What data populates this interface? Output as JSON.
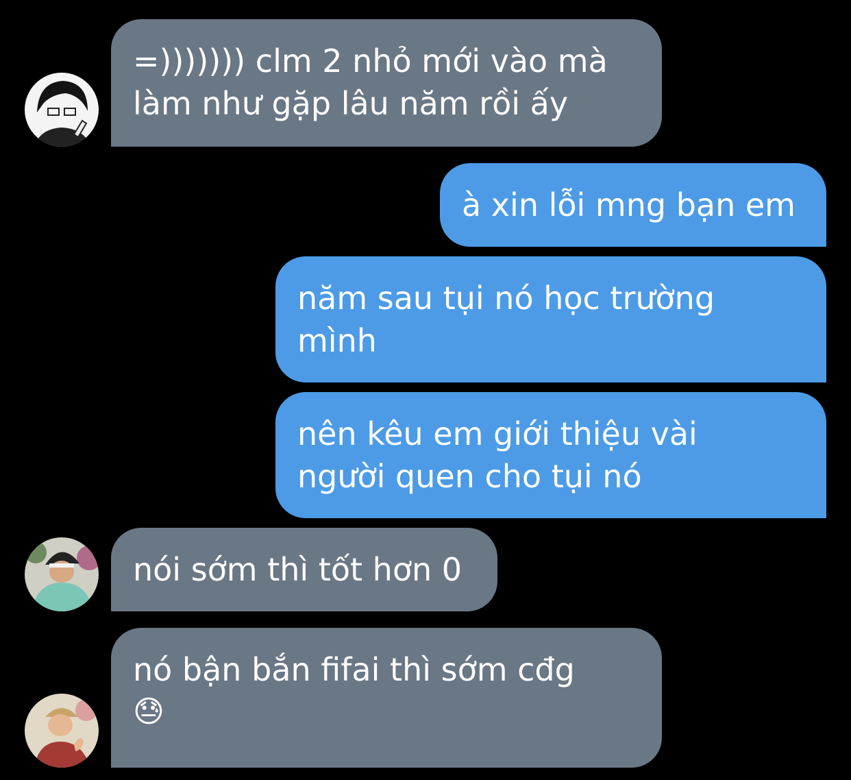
{
  "theme": {
    "background": "#000000",
    "incoming_bubble": "#6a7785",
    "outgoing_bubble": "#4d9be6",
    "text": "#ffffff"
  },
  "messages": [
    {
      "direction": "incoming",
      "avatar": "avatar-glasses-boy",
      "lines": [
        "=))))))) clm 2 nhỏ mới vào mà",
        "làm như gặp lâu năm rồi ấy"
      ]
    },
    {
      "direction": "outgoing",
      "lines": [
        "à xin lỗi mng bạn em"
      ]
    },
    {
      "direction": "outgoing",
      "lines": [
        "năm sau tụi nó học trường",
        "mình"
      ]
    },
    {
      "direction": "outgoing",
      "lines": [
        "nên kêu em giới thiệu vài",
        "người quen cho tụi nó"
      ]
    },
    {
      "direction": "incoming",
      "avatar": "avatar-green-shirt-boy",
      "lines": [
        "nói sớm thì tốt hơn 0"
      ]
    },
    {
      "direction": "incoming",
      "avatar": "avatar-red-scarf-boy",
      "lines": [
        "nó bận bắn fifai thì sớm cđg"
      ],
      "emoji": "😓"
    }
  ]
}
